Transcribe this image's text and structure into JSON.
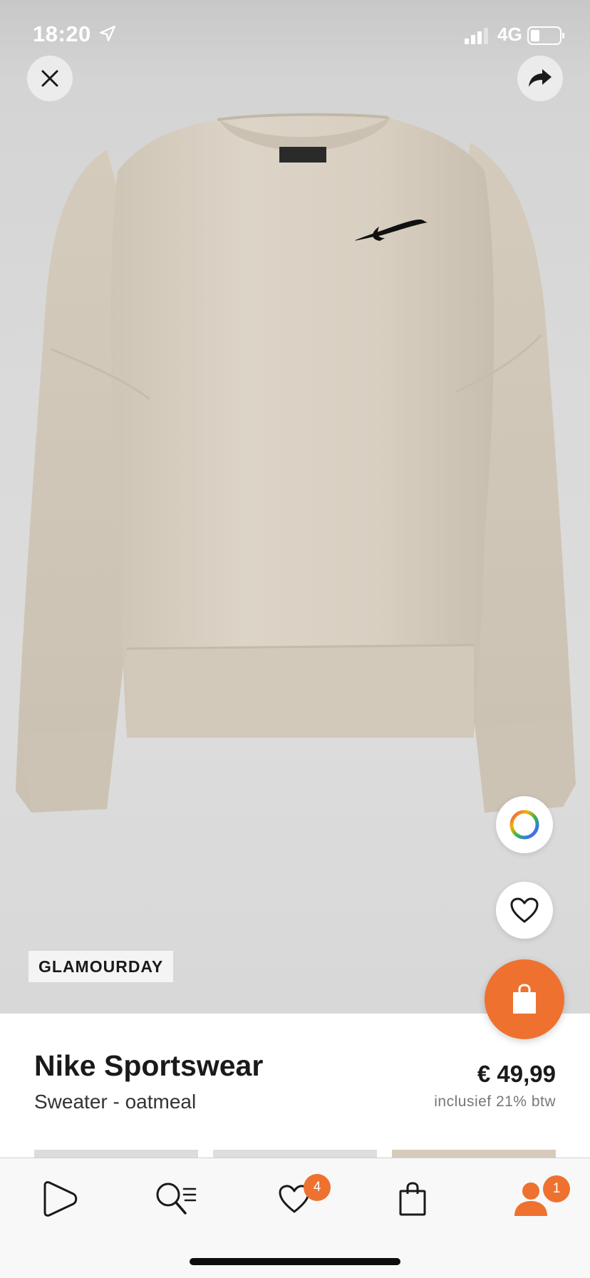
{
  "status_bar": {
    "time": "18:20",
    "network": "4G"
  },
  "product": {
    "brand_tag": "GLAMOURDAY",
    "brand": "Nike Sportswear",
    "name": "Sweater - oatmeal",
    "price": "€ 49,99",
    "vat_note": "inclusief 21% btw"
  },
  "tab_bar": {
    "wishlist_badge": "4",
    "account_badge": "1"
  },
  "colors": {
    "accent": "#ee7130",
    "garment": "#d9d0c2"
  },
  "icons": {
    "close": "close-icon",
    "share": "share-icon",
    "color": "color-wheel-icon",
    "wishlist": "heart-icon",
    "cart": "shopping-bag-icon",
    "home": "home-icon",
    "search": "search-icon",
    "account": "account-icon"
  }
}
